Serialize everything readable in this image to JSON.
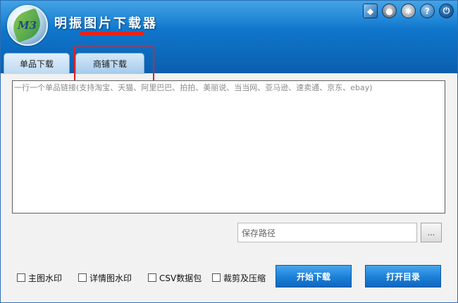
{
  "app": {
    "title": "明振图片下载器",
    "logo_text": "M3"
  },
  "toolbar_icons": [
    "cube-icon",
    "user-icon",
    "gear-icon",
    "help-icon",
    "power-icon"
  ],
  "tabs": [
    {
      "label": "单品下载",
      "active": false
    },
    {
      "label": "商铺下载",
      "active": true
    }
  ],
  "links_input": {
    "placeholder": "一行一个单品链接(支持淘宝、天猫、阿里巴巴、拍拍、美丽说、当当网、亚马逊、速卖通、京东、ebay)"
  },
  "save": {
    "placeholder": "保存路径",
    "browse_label": "..."
  },
  "options": [
    {
      "label": "主图水印",
      "checked": false
    },
    {
      "label": "详情图水印",
      "checked": false
    },
    {
      "label": "CSV数据包",
      "checked": false
    },
    {
      "label": "裁剪及压缩",
      "checked": false
    }
  ],
  "buttons": {
    "start": "开始下载",
    "open_dir": "打开目录"
  },
  "colors": {
    "header": "#0f74c9",
    "highlight": "#e22020",
    "button": "#1b7fd6"
  }
}
